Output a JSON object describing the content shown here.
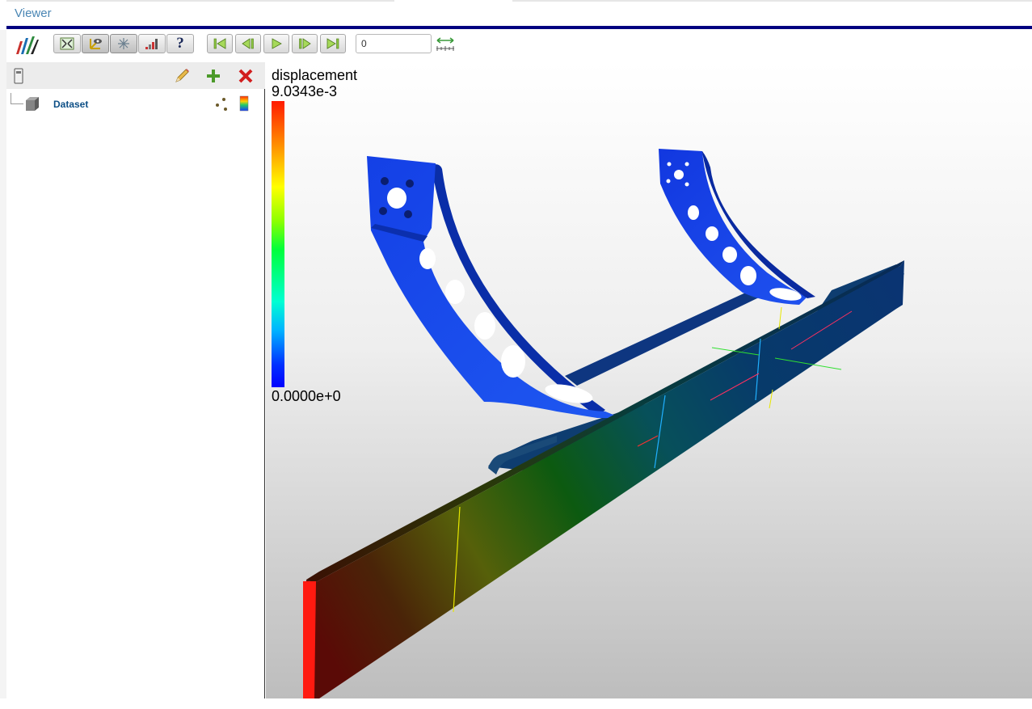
{
  "app": {
    "title": "Viewer"
  },
  "toolbar": {
    "frame_value": "0",
    "buttons": [
      {
        "name": "reset-camera-button",
        "icon": "reset-camera-icon",
        "active": false
      },
      {
        "name": "orientation-axes-button",
        "icon": "orientation-axes-icon",
        "active": true
      },
      {
        "name": "center-axes-button",
        "icon": "center-axes-icon",
        "active": true
      },
      {
        "name": "render-stats-button",
        "icon": "stats-icon",
        "active": false
      },
      {
        "name": "help-button",
        "icon": "help-icon",
        "label": "?",
        "active": false
      }
    ],
    "playback": [
      "first-frame-icon",
      "previous-frame-icon",
      "play-icon",
      "next-frame-icon",
      "last-frame-icon"
    ]
  },
  "pipeline": {
    "items": [
      {
        "label": "Dataset",
        "icon": "dataset-cube-icon"
      }
    ]
  },
  "viewport": {
    "legend": {
      "title": "displacement",
      "max": "9.0343e-3",
      "min": "0.0000e+0"
    }
  },
  "colors": {
    "title_text": "#4a86b4",
    "title_rule": "#000080",
    "dataset_label": "#0d4f86",
    "add_icon": "#4c9a2a",
    "delete_icon": "#d21e1e"
  }
}
